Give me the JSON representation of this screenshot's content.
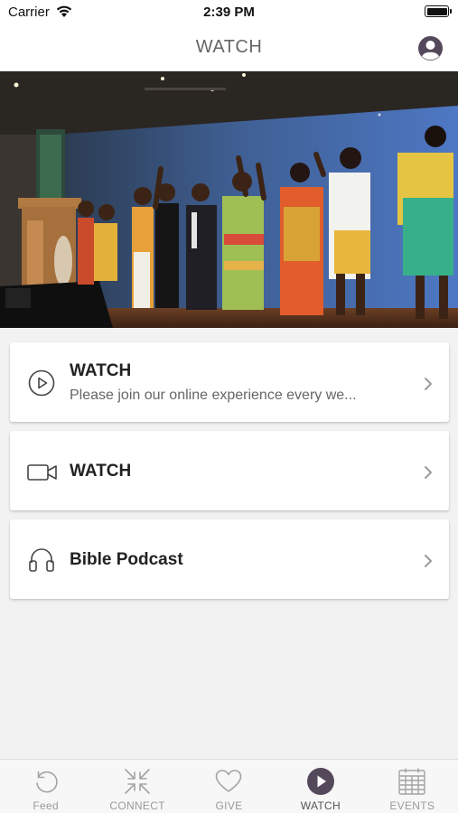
{
  "status_bar": {
    "carrier": "Carrier",
    "time": "2:39 PM"
  },
  "header": {
    "title": "WATCH",
    "profile_icon": "profile-icon"
  },
  "hero": {
    "image": "worship-team-singing-on-stage-photo"
  },
  "cards": [
    {
      "icon": "play-circle-icon",
      "title": "WATCH",
      "subtitle": "Please join our online experience every we..."
    },
    {
      "icon": "video-camera-icon",
      "title": "WATCH"
    },
    {
      "icon": "headphones-icon",
      "title": "Bible Podcast"
    }
  ],
  "tabs": [
    {
      "label": "Feed",
      "icon": "refresh-icon",
      "active": false
    },
    {
      "label": "CONNECT",
      "icon": "arrows-in-icon",
      "active": false
    },
    {
      "label": "GIVE",
      "icon": "heart-icon",
      "active": false
    },
    {
      "label": "WATCH",
      "icon": "play-circle-icon",
      "active": true
    },
    {
      "label": "EVENTS",
      "icon": "calendar-icon",
      "active": false
    }
  ],
  "colors": {
    "accent": "#54485b",
    "inactive": "#9a9a9a",
    "background": "#f2f2f2"
  }
}
